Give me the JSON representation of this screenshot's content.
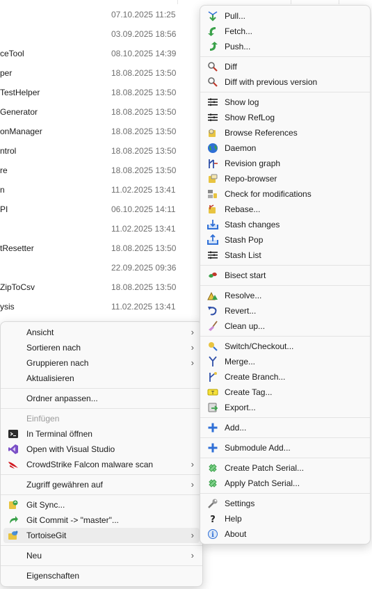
{
  "file_list": {
    "rows": [
      {
        "name": "",
        "date": "07.10.2025 11:25"
      },
      {
        "name": "",
        "date": "03.09.2025 18:56"
      },
      {
        "name": "ceTool",
        "date": "08.10.2025 14:39"
      },
      {
        "name": "per",
        "date": "18.08.2025 13:50"
      },
      {
        "name": "TestHelper",
        "date": "18.08.2025 13:50"
      },
      {
        "name": "Generator",
        "date": "18.08.2025 13:50"
      },
      {
        "name": "onManager",
        "date": "18.08.2025 13:50"
      },
      {
        "name": "ntrol",
        "date": "18.08.2025 13:50"
      },
      {
        "name": "re",
        "date": "18.08.2025 13:50"
      },
      {
        "name": "n",
        "date": "11.02.2025 13:41"
      },
      {
        "name": "PI",
        "date": "06.10.2025 14:11"
      },
      {
        "name": "",
        "date": "11.02.2025 13:41"
      },
      {
        "name": "tResetter",
        "date": "18.08.2025 13:50"
      },
      {
        "name": "",
        "date": "22.09.2025 09:36"
      },
      {
        "name": "ZipToCsv",
        "date": "18.08.2025 13:50"
      },
      {
        "name": "ysis",
        "date": "11.02.2025 13:41"
      }
    ]
  },
  "context_menu": {
    "items": [
      {
        "label": "Ansicht",
        "icon": "",
        "submenu": true
      },
      {
        "label": "Sortieren nach",
        "icon": "",
        "submenu": true
      },
      {
        "label": "Gruppieren nach",
        "icon": "",
        "submenu": true
      },
      {
        "label": "Aktualisieren",
        "icon": ""
      },
      {
        "label": "Ordner anpassen...",
        "icon": ""
      },
      {
        "label": "Einfügen",
        "icon": "",
        "disabled": true
      },
      {
        "label": "In Terminal öffnen",
        "icon": "terminal-icon"
      },
      {
        "label": "Open with Visual Studio",
        "icon": "visual-studio-icon"
      },
      {
        "label": "CrowdStrike Falcon malware scan",
        "icon": "crowdstrike-icon",
        "submenu": true
      },
      {
        "label": "Zugriff gewähren auf",
        "icon": "",
        "submenu": true
      },
      {
        "label": "Git Sync...",
        "icon": "git-sync-icon"
      },
      {
        "label": "Git Commit -> \"master\"...",
        "icon": "git-commit-icon"
      },
      {
        "label": "TortoiseGit",
        "icon": "tortoisegit-icon",
        "submenu": true,
        "highlighted": true
      },
      {
        "label": "Neu",
        "icon": "",
        "submenu": true
      },
      {
        "label": "Eigenschaften",
        "icon": ""
      }
    ]
  },
  "tortoisegit_menu": {
    "items": [
      {
        "label": "Pull...",
        "icon": "pull-icon"
      },
      {
        "label": "Fetch...",
        "icon": "fetch-icon"
      },
      {
        "label": "Push...",
        "icon": "push-icon"
      },
      {
        "label": "Diff",
        "icon": "diff-icon"
      },
      {
        "label": "Diff with previous version",
        "icon": "diff-previous-icon"
      },
      {
        "label": "Show log",
        "icon": "show-log-icon"
      },
      {
        "label": "Show RefLog",
        "icon": "show-reflog-icon"
      },
      {
        "label": "Browse References",
        "icon": "browse-references-icon"
      },
      {
        "label": "Daemon",
        "icon": "daemon-globe-icon"
      },
      {
        "label": "Revision graph",
        "icon": "revision-graph-icon"
      },
      {
        "label": "Repo-browser",
        "icon": "repo-browser-icon"
      },
      {
        "label": "Check for modifications",
        "icon": "check-modifications-icon"
      },
      {
        "label": "Rebase...",
        "icon": "rebase-icon"
      },
      {
        "label": "Stash changes",
        "icon": "stash-changes-icon"
      },
      {
        "label": "Stash Pop",
        "icon": "stash-pop-icon"
      },
      {
        "label": "Stash List",
        "icon": "stash-list-icon"
      },
      {
        "label": "Bisect start",
        "icon": "bisect-icon"
      },
      {
        "label": "Resolve...",
        "icon": "resolve-icon"
      },
      {
        "label": "Revert...",
        "icon": "revert-icon"
      },
      {
        "label": "Clean up...",
        "icon": "cleanup-broom-icon"
      },
      {
        "label": "Switch/Checkout...",
        "icon": "switch-checkout-icon"
      },
      {
        "label": "Merge...",
        "icon": "merge-icon"
      },
      {
        "label": "Create Branch...",
        "icon": "create-branch-icon"
      },
      {
        "label": "Create Tag...",
        "icon": "create-tag-icon"
      },
      {
        "label": "Export...",
        "icon": "export-icon"
      },
      {
        "label": "Add...",
        "icon": "add-plus-icon"
      },
      {
        "label": "Submodule Add...",
        "icon": "submodule-add-icon"
      },
      {
        "label": "Create Patch Serial...",
        "icon": "create-patch-icon"
      },
      {
        "label": "Apply Patch Serial...",
        "icon": "apply-patch-icon"
      },
      {
        "label": "Settings",
        "icon": "settings-wrench-icon"
      },
      {
        "label": "Help",
        "icon": "help-icon"
      },
      {
        "label": "About",
        "icon": "about-info-icon"
      }
    ]
  },
  "colors": {
    "menu_bg": "#f9f9f9",
    "highlight": "#ececec",
    "date_text": "#6e6e6e",
    "add_blue": "#2f6fd6"
  }
}
